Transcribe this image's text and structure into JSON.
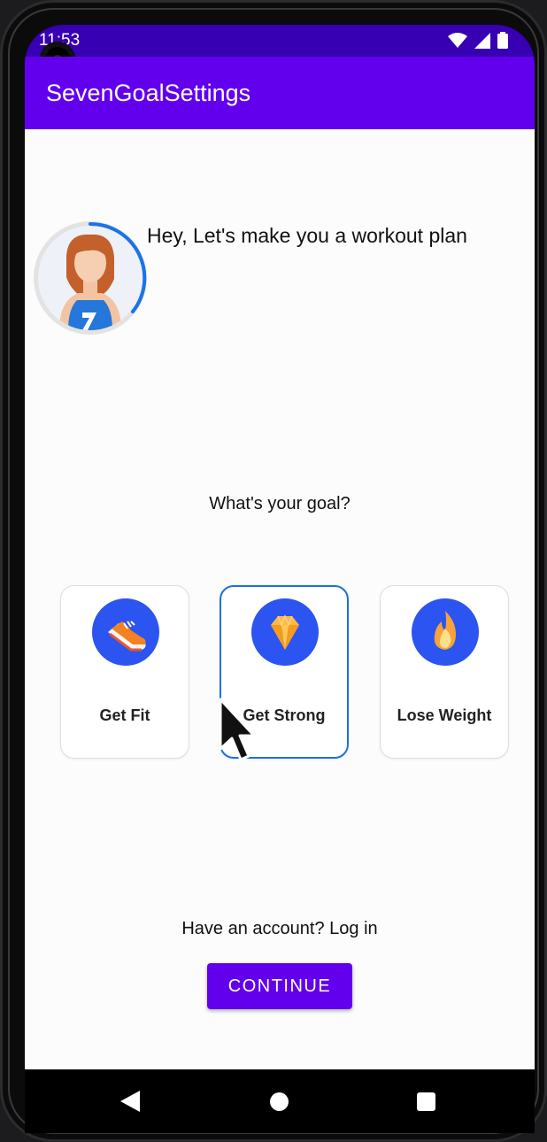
{
  "status_bar": {
    "time": "11:53",
    "icons": [
      "wifi-icon",
      "signal-icon",
      "battery-icon"
    ]
  },
  "app_bar": {
    "title": "SevenGoalSettings"
  },
  "header": {
    "greeting": "Hey, Let's make you a workout plan",
    "avatar_badge": "7"
  },
  "goals": {
    "question": "What's your goal?",
    "options": [
      {
        "label": "Get Fit",
        "icon": "sneaker-icon",
        "selected": false
      },
      {
        "label": "Get Strong",
        "icon": "diamond-icon",
        "selected": true
      },
      {
        "label": "Lose Weight",
        "icon": "flame-icon",
        "selected": false
      }
    ]
  },
  "footer": {
    "login_prompt": "Have an account? Log in",
    "continue_label": "CONTINUE"
  },
  "navigation": {
    "buttons": [
      "back-icon",
      "home-icon",
      "recents-icon"
    ]
  },
  "colors": {
    "primary": "#6200ee",
    "primary_dark": "#3700b3",
    "icon_circle": "#2c54f0",
    "selected_border": "#1e6fe0"
  }
}
